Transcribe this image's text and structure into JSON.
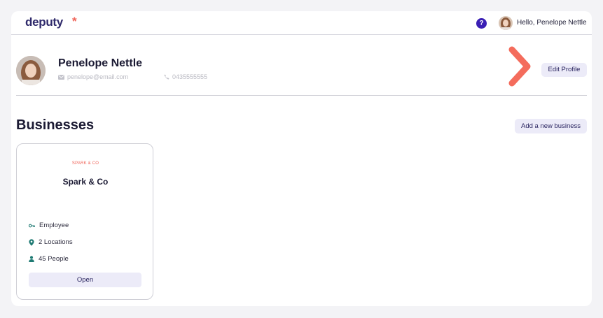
{
  "brand": {
    "logo_text": "deputy",
    "logo_mark": "*",
    "accent": "#f0655a",
    "primary": "#3a1fb4"
  },
  "nav": {
    "help_label": "?",
    "greeting": "Hello, Penelope Nettle"
  },
  "profile": {
    "name": "Penelope Nettle",
    "email": "penelope@email.com",
    "phone": "0435555555",
    "edit_label": "Edit Profile"
  },
  "businesses": {
    "title": "Businesses",
    "add_label": "Add a new business",
    "cards": [
      {
        "logo_text": "SPARK & CO",
        "name": "Spark & Co",
        "role": "Employee",
        "locations": "2 Locations",
        "people": "45 People",
        "open_label": "Open"
      }
    ]
  },
  "icons": [
    "help-icon",
    "mail-icon",
    "phone-icon",
    "key-icon",
    "location-pin-icon",
    "person-icon",
    "chevron-right-icon"
  ]
}
